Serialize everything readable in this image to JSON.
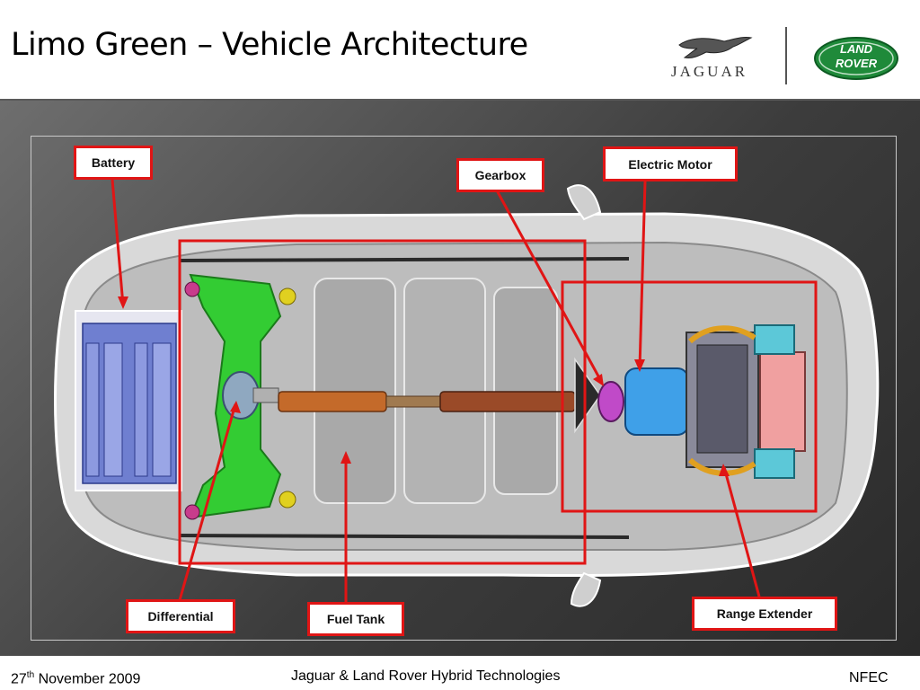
{
  "slide": {
    "title": "Limo Green – Vehicle Architecture"
  },
  "logos": {
    "jaguar_word": "JAGUAR",
    "landrover_line1": "LAND",
    "landrover_line2": "ROVER"
  },
  "labels": {
    "battery": "Battery",
    "gearbox": "Gearbox",
    "electric_motor": "Electric Motor",
    "differential": "Differential",
    "fuel_tank": "Fuel Tank",
    "range_extender": "Range Extender"
  },
  "footer": {
    "date_day": "27",
    "date_suffix": "th",
    "date_rest": " November 2009",
    "center": "Jaguar & Land Rover Hybrid Technologies",
    "right": "NFEC"
  },
  "colors": {
    "highlight_red": "#e01515",
    "subframe_green": "#33cc33",
    "motor_blue": "#3fa0e8",
    "battery_blue": "#6f7fd0",
    "shaft_orange": "#c46a2a",
    "landrover_green": "#1f8a3a"
  }
}
